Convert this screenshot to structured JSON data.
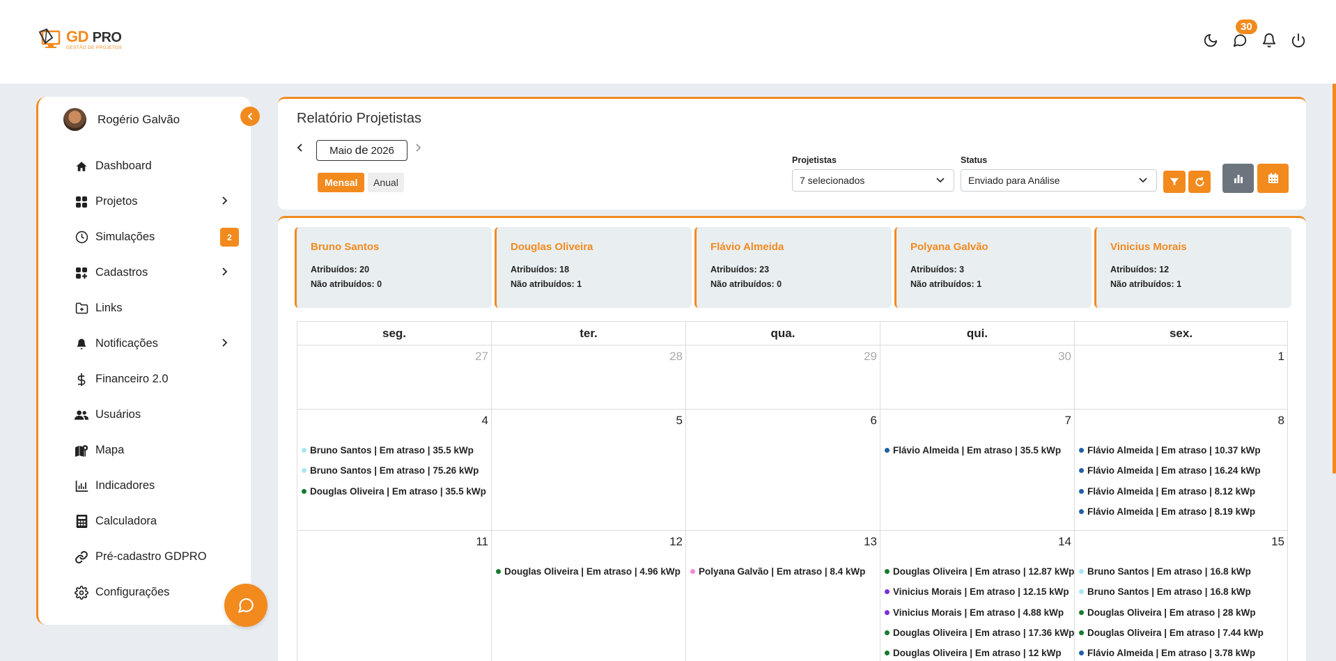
{
  "brand": {
    "title_a": "GD",
    "title_b": "PRO",
    "subtitle": "GESTÃO DE PROJETOS",
    "accent": "#f28a1e"
  },
  "header": {
    "messages_badge": "30"
  },
  "sidebar": {
    "user_name": "Rogério Galvão",
    "items": [
      {
        "label": "Dashboard",
        "icon": "home-icon"
      },
      {
        "label": "Projetos",
        "icon": "grid-icon",
        "chevron": true
      },
      {
        "label": "Simulações",
        "icon": "clock-icon",
        "badge": "2"
      },
      {
        "label": "Cadastros",
        "icon": "grid-plus-icon",
        "chevron": true
      },
      {
        "label": "Links",
        "icon": "folder-plus-icon"
      },
      {
        "label": "Notificações",
        "icon": "bell-icon",
        "chevron": true
      },
      {
        "label": "Financeiro 2.0",
        "icon": "dollar-icon"
      },
      {
        "label": "Usuários",
        "icon": "users-icon"
      },
      {
        "label": "Mapa",
        "icon": "map-icon"
      },
      {
        "label": "Indicadores",
        "icon": "bar-chart-icon"
      },
      {
        "label": "Calculadora",
        "icon": "calculator-icon"
      },
      {
        "label": "Pré-cadastro GDPRO",
        "icon": "link-icon"
      },
      {
        "label": "Configurações",
        "icon": "gear-icon"
      }
    ]
  },
  "report": {
    "title": "Relatório Projetistas",
    "month_label": "Maio",
    "month_connector": "de",
    "year": "2026",
    "view_monthly": "Mensal",
    "view_annual": "Anual",
    "filter_designers_label": "Projetistas",
    "filter_designers_value": "7 selecionados",
    "filter_status_label": "Status",
    "filter_status_value": "Enviado para Análise"
  },
  "cards": [
    {
      "name": "Bruno Santos",
      "assigned": "Atribuídos: 20",
      "unassigned": "Não atribuídos: 0"
    },
    {
      "name": "Douglas Oliveira",
      "assigned": "Atribuídos: 18",
      "unassigned": "Não atribuídos: 1"
    },
    {
      "name": "Flávio Almeida",
      "assigned": "Atribuídos: 23",
      "unassigned": "Não atribuídos: 0"
    },
    {
      "name": "Polyana Galvão",
      "assigned": "Atribuídos: 3",
      "unassigned": "Não atribuídos: 1"
    },
    {
      "name": "Vinicius Morais",
      "assigned": "Atribuídos: 12",
      "unassigned": "Não atribuídos: 1"
    }
  ],
  "calendar": {
    "weekdays": [
      "seg.",
      "ter.",
      "qua.",
      "qui.",
      "sex."
    ],
    "weeks": [
      {
        "days": [
          {
            "num": "27",
            "muted": true,
            "events": []
          },
          {
            "num": "28",
            "muted": true,
            "events": []
          },
          {
            "num": "29",
            "muted": true,
            "events": []
          },
          {
            "num": "30",
            "muted": true,
            "events": []
          },
          {
            "num": "1",
            "muted": false,
            "events": []
          }
        ]
      },
      {
        "days": [
          {
            "num": "4",
            "events": [
              {
                "text": "Bruno Santos | Em atraso | 35.5 kWp",
                "color": "#a8e6f5"
              },
              {
                "text": "Bruno Santos | Em atraso | 75.26 kWp",
                "color": "#a8e6f5"
              },
              {
                "text": "Douglas Oliveira | Em atraso | 35.5 kWp",
                "color": "#157a2e"
              }
            ]
          },
          {
            "num": "5",
            "events": []
          },
          {
            "num": "6",
            "events": []
          },
          {
            "num": "7",
            "events": [
              {
                "text": "Flávio Almeida | Em atraso | 35.5 kWp",
                "color": "#1f5fa8"
              }
            ]
          },
          {
            "num": "8",
            "events": [
              {
                "text": "Flávio Almeida | Em atraso | 10.37 kWp",
                "color": "#1f5fa8"
              },
              {
                "text": "Flávio Almeida | Em atraso | 16.24 kWp",
                "color": "#1f5fa8"
              },
              {
                "text": "Flávio Almeida | Em atraso | 8.12 kWp",
                "color": "#1f5fa8"
              },
              {
                "text": "Flávio Almeida | Em atraso | 8.19 kWp",
                "color": "#1f5fa8"
              }
            ]
          }
        ]
      },
      {
        "days": [
          {
            "num": "11",
            "events": []
          },
          {
            "num": "12",
            "events": [
              {
                "text": "Douglas Oliveira | Em atraso | 4.96 kWp",
                "color": "#157a2e"
              }
            ]
          },
          {
            "num": "13",
            "events": [
              {
                "text": "Polyana Galvão | Em atraso | 8.4 kWp",
                "color": "#f08ad8"
              }
            ]
          },
          {
            "num": "14",
            "events": [
              {
                "text": "Douglas Oliveira | Em atraso | 12.87 kWp",
                "color": "#157a2e"
              },
              {
                "text": "Vinicius Morais | Em atraso | 12.15 kWp",
                "color": "#7b2fd6"
              },
              {
                "text": "Vinicius Morais | Em atraso | 4.88 kWp",
                "color": "#7b2fd6"
              },
              {
                "text": "Douglas Oliveira | Em atraso | 17.36 kWp",
                "color": "#157a2e"
              },
              {
                "text": "Douglas Oliveira | Em atraso | 12 kWp",
                "color": "#157a2e"
              }
            ]
          },
          {
            "num": "15",
            "events": [
              {
                "text": "Bruno Santos | Em atraso | 16.8 kWp",
                "color": "#a8e6f5"
              },
              {
                "text": "Bruno Santos | Em atraso | 16.8 kWp",
                "color": "#a8e6f5"
              },
              {
                "text": "Douglas Oliveira | Em atraso | 28 kWp",
                "color": "#157a2e"
              },
              {
                "text": "Douglas Oliveira | Em atraso | 7.44 kWp",
                "color": "#157a2e"
              },
              {
                "text": "Flávio Almeida | Em atraso | 3.78 kWp",
                "color": "#1f5fa8"
              }
            ]
          }
        ]
      }
    ]
  }
}
